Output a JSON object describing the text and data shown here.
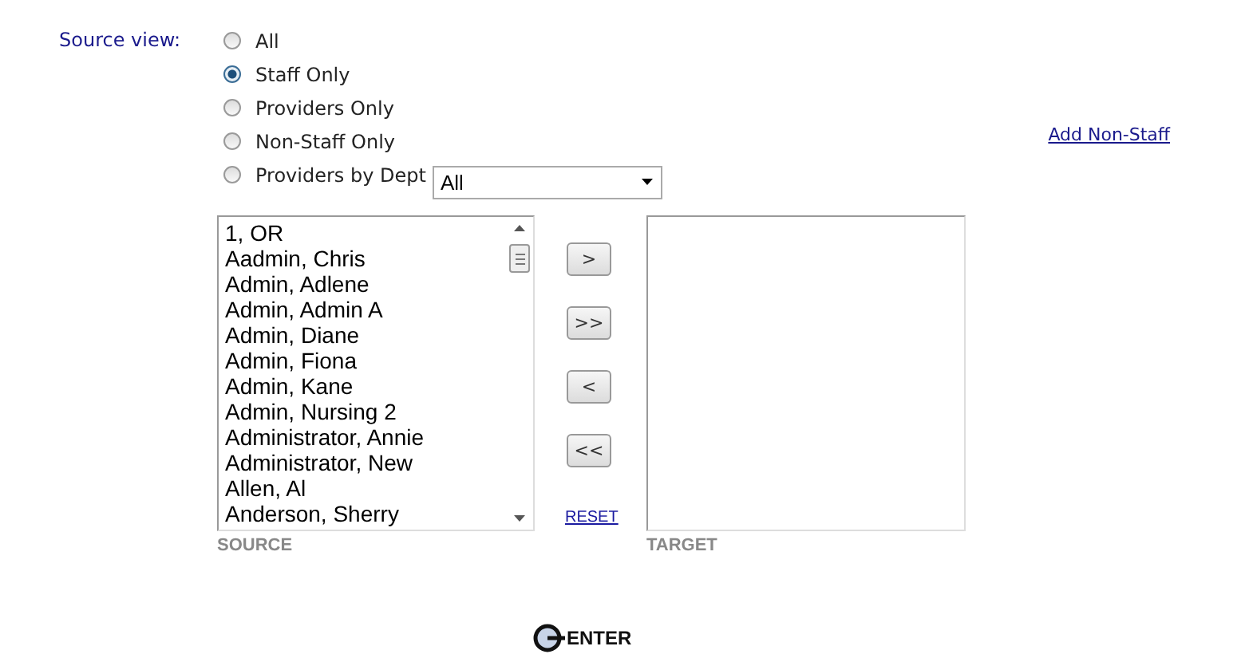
{
  "source_view": {
    "label": "Source view:",
    "options": [
      {
        "label": "All",
        "selected": false
      },
      {
        "label": "Staff Only",
        "selected": true
      },
      {
        "label": "Providers Only",
        "selected": false
      },
      {
        "label": "Non-Staff Only",
        "selected": false
      },
      {
        "label": "Providers by Dept",
        "selected": false,
        "kind": "dropdown",
        "value": "All"
      }
    ]
  },
  "add_link": "Add Non-Staff",
  "source": {
    "items": [
      "1, OR",
      "Aadmin, Chris",
      "Admin, Adlene",
      "Admin, Admin A",
      "Admin, Diane",
      "Admin, Fiona",
      "Admin, Kane",
      "Admin, Nursing 2",
      "Administrator, Annie",
      "Administrator, New",
      "Allen, Al",
      "Anderson, Sherry"
    ],
    "caption": "SOURCE"
  },
  "transfer_buttons": [
    ">",
    ">>",
    "<",
    "<<"
  ],
  "reset": "RESET",
  "target": {
    "caption": "TARGET"
  },
  "enter": "ENTER"
}
